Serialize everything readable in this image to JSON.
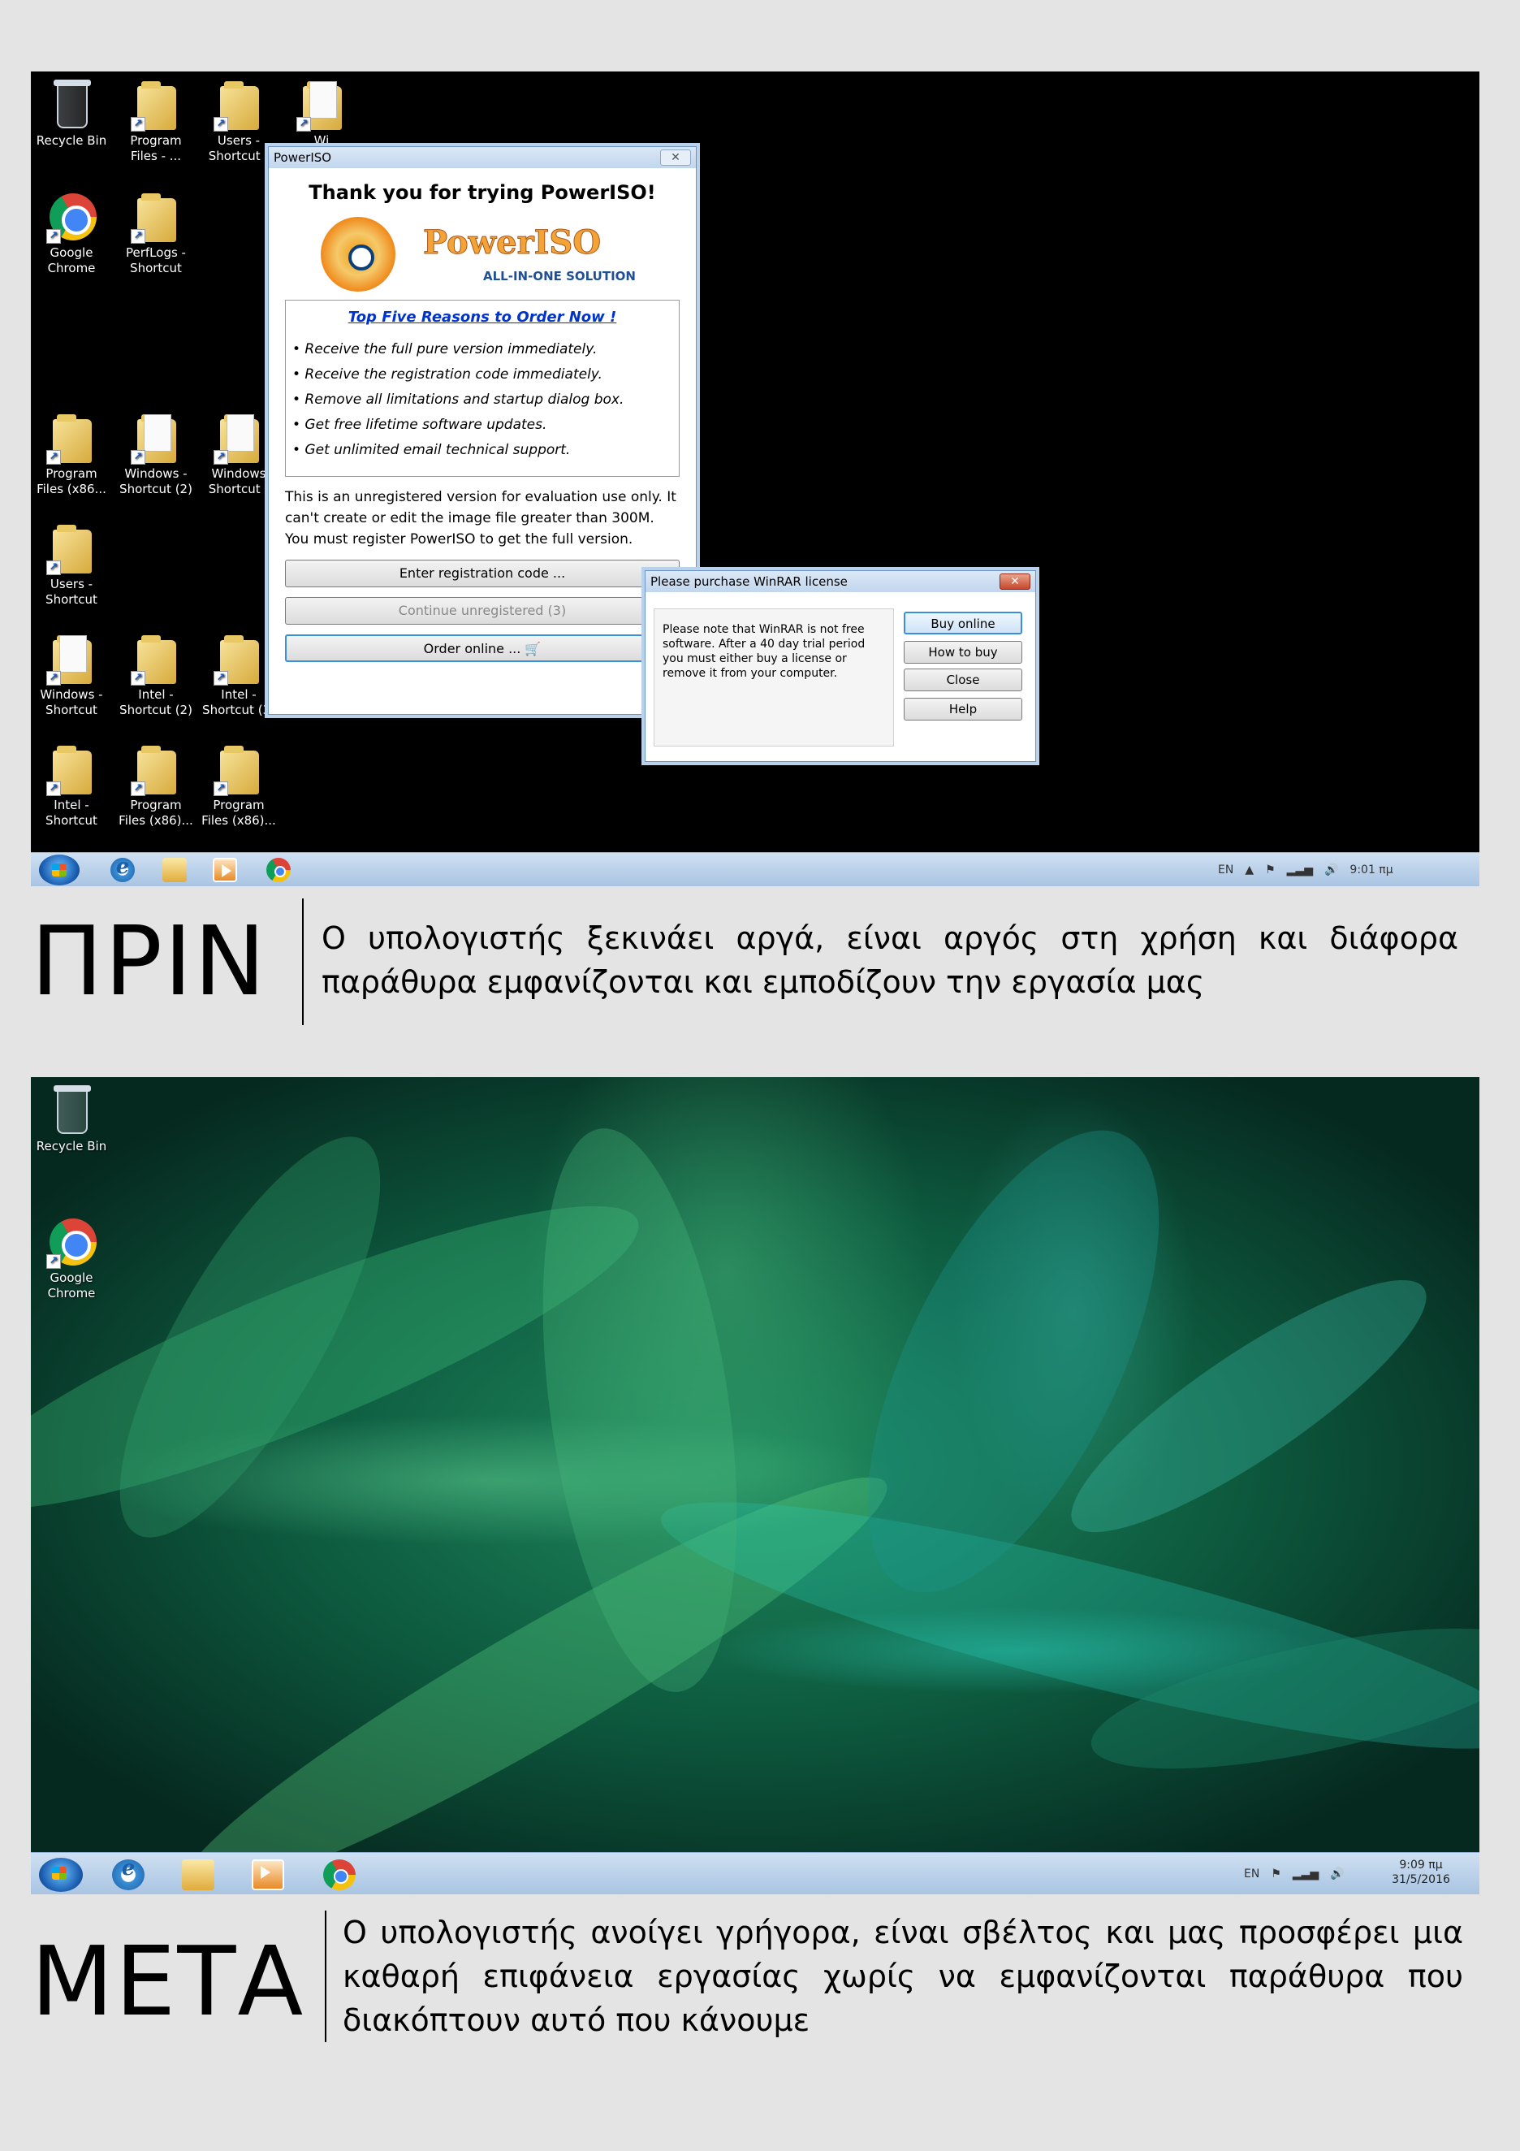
{
  "before": {
    "desktop_icons": [
      {
        "label": "Recycle Bin",
        "type": "bin"
      },
      {
        "label": "Program\nFiles - ...",
        "type": "folder"
      },
      {
        "label": "Users -\nShortcut (",
        "type": "folder"
      },
      {
        "label": "Wi",
        "type": "folder"
      },
      {
        "label": "Google\nChrome",
        "type": "chrome"
      },
      {
        "label": "PerfLogs -\nShortcut",
        "type": "folder"
      },
      {
        "label": "Program\nFiles (x86...",
        "type": "folder"
      },
      {
        "label": "Windows -\nShortcut (2)",
        "type": "folder"
      },
      {
        "label": "Windows\nShortcut (",
        "type": "folder"
      },
      {
        "label": "Users -\nShortcut",
        "type": "folder"
      },
      {
        "label": "Windows -\nShortcut",
        "type": "folder"
      },
      {
        "label": "Intel -\nShortcut (2)",
        "type": "folder"
      },
      {
        "label": "Intel -\nShortcut (3)",
        "type": "folder"
      },
      {
        "label": "Intel -\nShortcut",
        "type": "folder"
      },
      {
        "label": "Program\nFiles (x86)...",
        "type": "folder"
      },
      {
        "label": "Program\nFiles (x86)...",
        "type": "folder"
      }
    ],
    "poweriso": {
      "title": "PowerISO",
      "close_glyph": "✕",
      "heading": "Thank you for trying PowerISO!",
      "brand": "PowerISO",
      "tagline": "ALL-IN-ONE SOLUTION",
      "reasons_title": "Top Five Reasons to Order Now !",
      "reasons": [
        "• Receive the full pure version immediately.",
        "• Receive the registration code immediately.",
        "• Remove all limitations and startup dialog box.",
        "• Get free lifetime software updates.",
        "• Get unlimited email technical support."
      ],
      "note": "This is an unregistered version for evaluation use only. It can't create or edit the image file greater than 300M. You must register PowerISO to get the full version.",
      "btn_register": "Enter registration code ...",
      "btn_continue": "Continue unregistered (3)",
      "btn_order": "Order online ...  🛒"
    },
    "winrar": {
      "title": "Please purchase WinRAR license",
      "close_glyph": "✕",
      "message": "Please note that WinRAR is not free software. After a 40 day trial period you must either buy a license or remove it from your computer.",
      "btn_buy": "Buy online",
      "btn_how": "How to buy",
      "btn_close": "Close",
      "btn_help": "Help"
    },
    "taskbar": {
      "lang": "EN",
      "tray_up": "▲",
      "flag": "⚑",
      "signal": "▂▃▅",
      "volume": "🔊",
      "time": "9:01 πμ"
    },
    "caption_title": "ΠΡΙΝ",
    "caption_text": "Ο υπολογιστής ξεκινάει αργά, είναι αργός στη χρήση και διάφορα παράθυρα εμφανίζονται και εμποδίζουν την εργασία μας"
  },
  "after": {
    "desktop_icons": [
      {
        "label": "Recycle Bin",
        "type": "bin"
      },
      {
        "label": "Google\nChrome",
        "type": "chrome"
      }
    ],
    "taskbar": {
      "lang": "EN",
      "flag": "⚑",
      "signal": "▂▃▅",
      "volume": "🔊",
      "time": "9:09 πμ",
      "date": "31/5/2016"
    },
    "caption_title": "ΜΕΤΑ",
    "caption_text": "Ο υπολογιστής ανοίγει γρήγορα, είναι σβέλτος και μας προσφέρει μια καθαρή επιφάνεια εργασίας χωρίς να εμφανίζονται παράθυρα που διακόπτουν αυτό που κάνουμε"
  },
  "colors": {
    "page_bg": "#e4e4e4",
    "taskbar": "#b9d1ea",
    "link_blue": "#0033cc",
    "poweriso_orange": "#f4a436",
    "wallpaper_green": "#1f8a5e"
  }
}
